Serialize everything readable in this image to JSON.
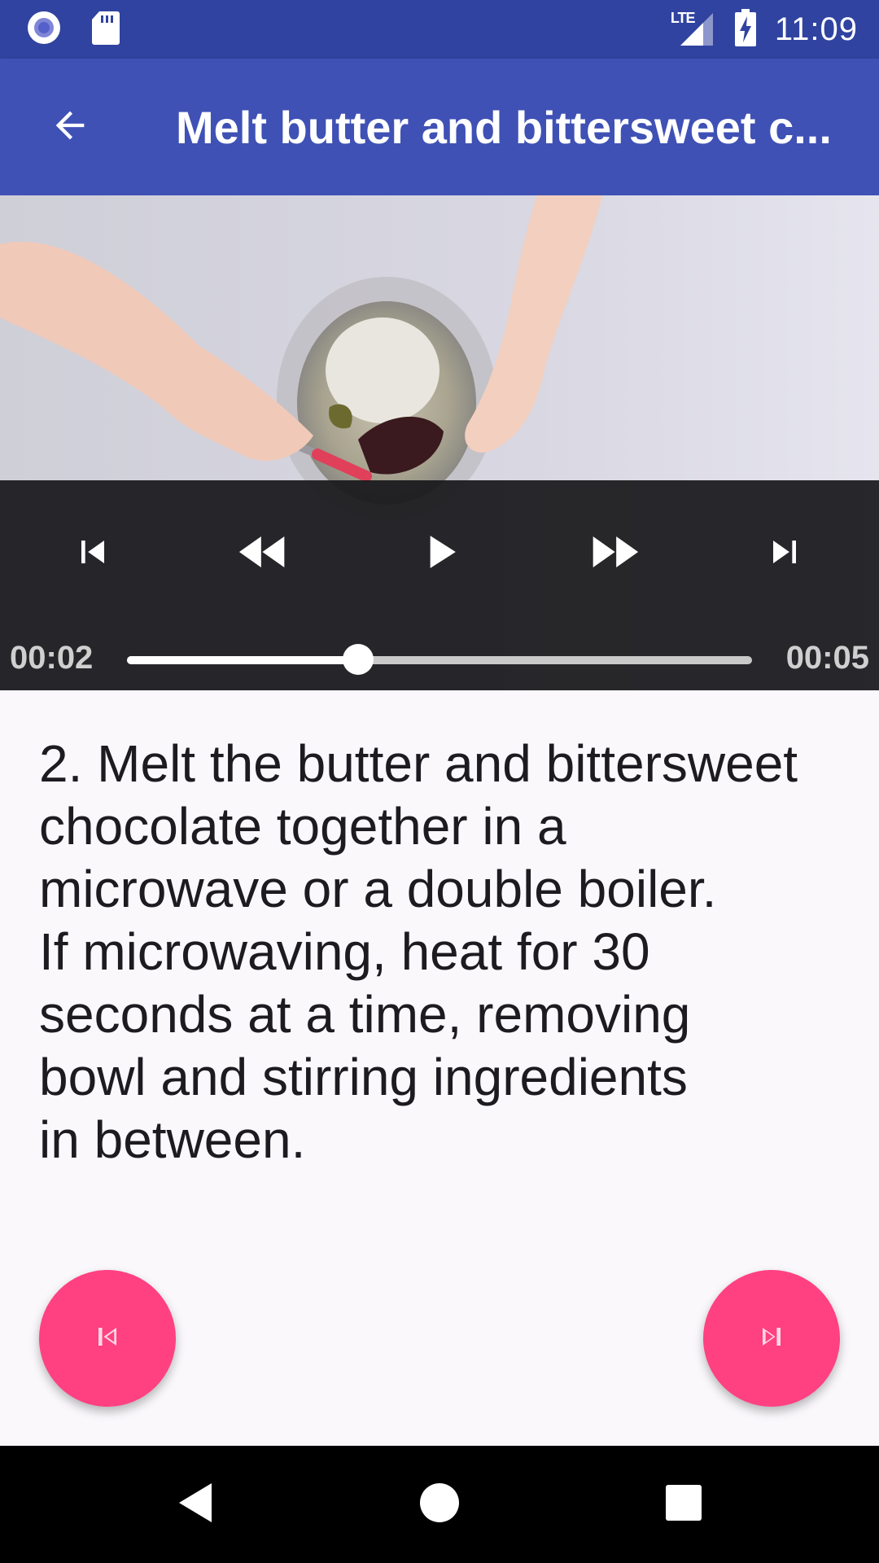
{
  "status_bar": {
    "time": "11:09",
    "network_label": "LTE",
    "icons": [
      "circle-notification-icon",
      "sd-card-icon",
      "lte-signal-icon",
      "battery-charging-icon"
    ]
  },
  "app_bar": {
    "title": "Melt butter and bittersweet c...",
    "back_icon": "arrow-back-icon",
    "color": "#3f51b5",
    "status_color": "#3043a0"
  },
  "player": {
    "position": "00:02",
    "duration": "00:05",
    "progress": 0.37,
    "controls": [
      "skip-previous-icon",
      "rewind-icon",
      "play-icon",
      "fast-forward-icon",
      "skip-next-icon"
    ]
  },
  "step": {
    "text": "2. Melt the butter and bittersweet\nchocolate together in a\nmicrowave or a double boiler.\nIf microwaving, heat for 30\nseconds at a time, removing\nbowl and stirring ingredients\nin between."
  },
  "fabs": {
    "previous_icon": "skip-previous-icon",
    "next_icon": "skip-next-icon",
    "color": "#ff4081"
  },
  "nav_bar": {
    "icons": [
      "nav-back-icon",
      "nav-home-icon",
      "nav-recents-icon"
    ]
  }
}
